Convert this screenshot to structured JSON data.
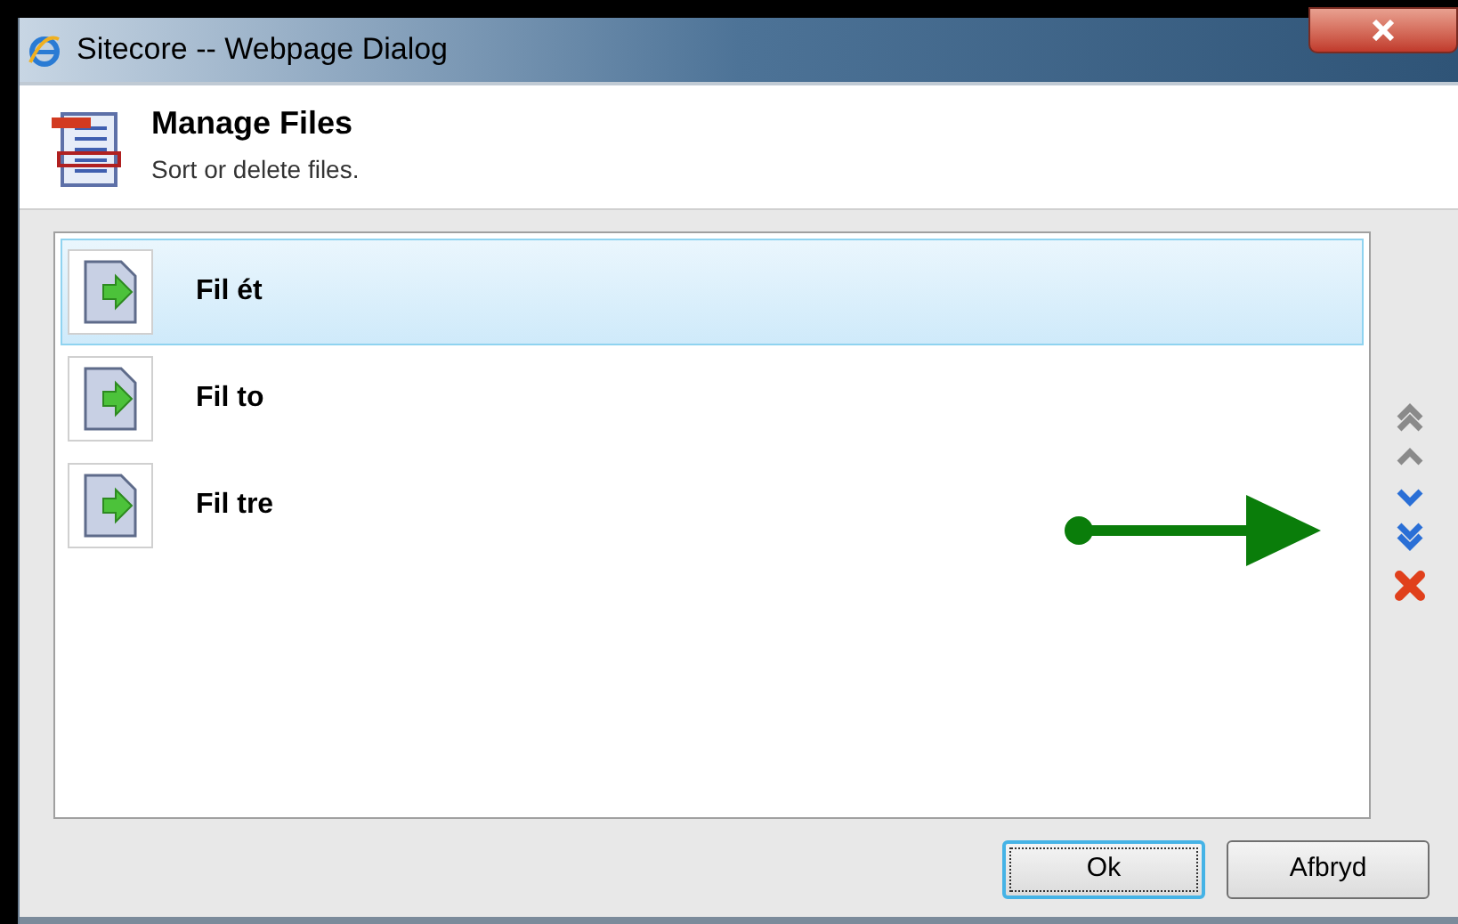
{
  "window": {
    "title": "Sitecore -- Webpage Dialog"
  },
  "header": {
    "title": "Manage Files",
    "subtitle": "Sort or delete files."
  },
  "files": [
    {
      "name": "Fil ét",
      "selected": true
    },
    {
      "name": "Fil to",
      "selected": false
    },
    {
      "name": "Fil tre",
      "selected": false
    }
  ],
  "tools": [
    {
      "kind": "top",
      "disabled": true
    },
    {
      "kind": "up",
      "disabled": true
    },
    {
      "kind": "down",
      "disabled": false
    },
    {
      "kind": "bottom",
      "disabled": false
    },
    {
      "kind": "delete",
      "disabled": false
    }
  ],
  "buttons": [
    {
      "label": "Ok",
      "focused": true
    },
    {
      "label": "Afbryd",
      "focused": false
    }
  ]
}
